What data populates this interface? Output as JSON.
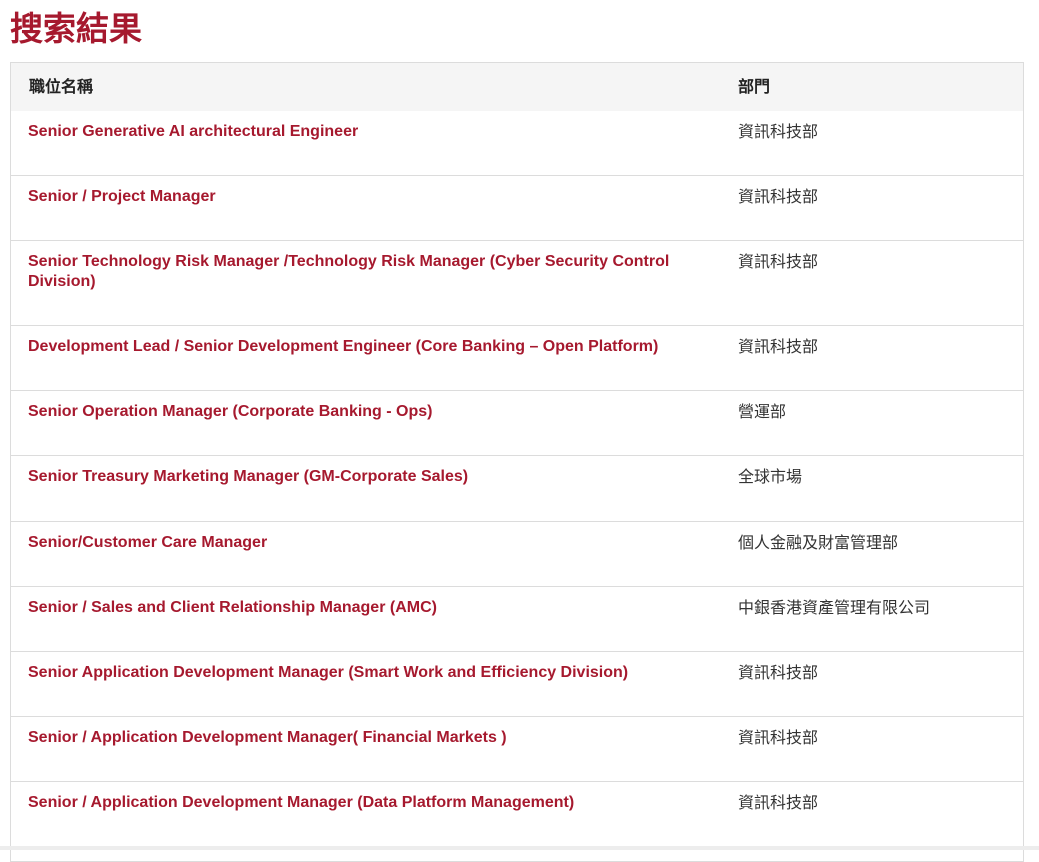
{
  "page": {
    "title": "搜索結果"
  },
  "table": {
    "headers": {
      "title": "職位名稱",
      "department": "部門"
    },
    "rows": [
      {
        "title": "Senior Generative AI architectural Engineer",
        "department": "資訊科技部"
      },
      {
        "title": "Senior / Project Manager",
        "department": "資訊科技部"
      },
      {
        "title": "Senior Technology Risk Manager /Technology Risk Manager (Cyber Security Control Division)",
        "department": "資訊科技部"
      },
      {
        "title": "Development Lead / Senior Development Engineer (Core Banking – Open Platform)",
        "department": "資訊科技部"
      },
      {
        "title": "Senior Operation Manager (Corporate Banking - Ops)",
        "department": "營運部"
      },
      {
        "title": "Senior Treasury Marketing Manager (GM-Corporate Sales)",
        "department": "全球市場"
      },
      {
        "title": "Senior/Customer Care Manager",
        "department": "個人金融及財富管理部"
      },
      {
        "title": "Senior / Sales and Client Relationship Manager  (AMC)",
        "department": "中銀香港資產管理有限公司"
      },
      {
        "title": "Senior Application Development Manager (Smart Work and Efficiency Division)",
        "department": "資訊科技部"
      },
      {
        "title": "Senior / Application Development Manager( Financial Markets )",
        "department": "資訊科技部"
      },
      {
        "title": "Senior / Application Development Manager (Data Platform Management)",
        "department": "資訊科技部"
      }
    ]
  },
  "colors": {
    "accent": "#a6192e",
    "header_bg": "#f5f5f5",
    "border": "#dcdcdc"
  }
}
